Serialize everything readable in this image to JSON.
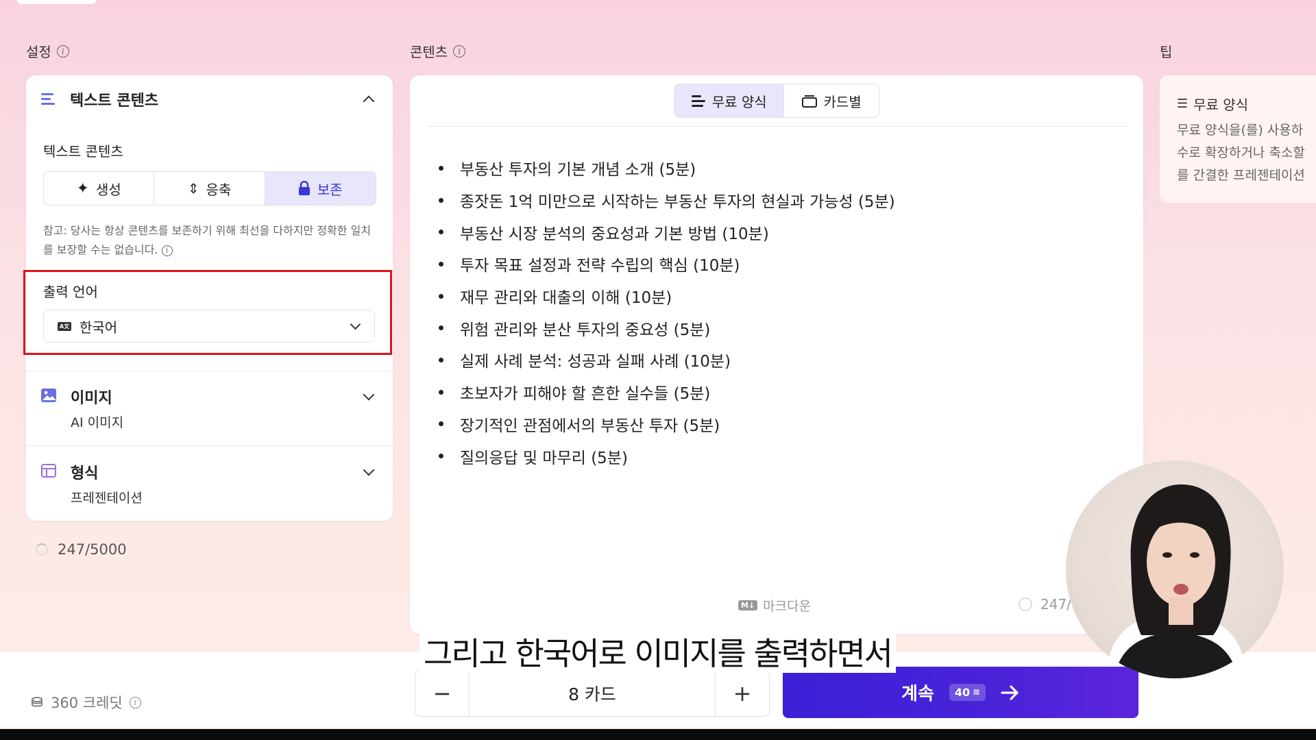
{
  "settings": {
    "label": "설정",
    "text_section": {
      "title": "텍스트 콘텐츠",
      "sub_label": "텍스트 콘텐츠",
      "modes": [
        {
          "label": "생성",
          "icon": "sparkle-icon"
        },
        {
          "label": "응축",
          "icon": "condense-icon"
        },
        {
          "label": "보존",
          "icon": "lock-icon",
          "active": true
        }
      ],
      "note": "참고: 당사는 항상 콘텐츠를 보존하기 위해 최선을 다하지만 정확한 일치를 보장할 수는 없습니다."
    },
    "output_language": {
      "label": "출력 언어",
      "value": "한국어",
      "icon": "language-icon"
    },
    "image_section": {
      "title": "이미지",
      "value": "AI 이미지"
    },
    "format_section": {
      "title": "형식",
      "value": "프레젠테이션"
    },
    "char_count": "247/5000"
  },
  "content": {
    "label": "콘텐츠",
    "tabs": [
      {
        "label": "무료 양식",
        "active": true
      },
      {
        "label": "카드별",
        "active": false
      }
    ],
    "items": [
      "부동산 투자의 기본 개념 소개 (5분)",
      "종잣돈 1억 미만으로 시작하는 부동산 투자의 현실과 가능성 (5분)",
      "부동산 시장 분석의 중요성과 기본 방법 (10분)",
      "투자 목표 설정과 전략 수립의 핵심 (10분)",
      "재무 관리와 대출의 이해 (10분)",
      "위험 관리와 분산 투자의 중요성 (5분)",
      "실제 사례 분석: 성공과 실패 사례 (10분)",
      "초보자가 피해야 할 흔한 실수들 (5분)",
      "장기적인 관점에서의 부동산 투자 (5분)",
      "질의응답 및 마무리 (5분)"
    ],
    "markdown_label": "마크다운",
    "char_count": "247/"
  },
  "tips": {
    "label": "팁",
    "title": "무료 양식",
    "lines": [
      "무료 양식을(를) 사용하",
      "수로 확장하거나 축소할",
      "를 간결한 프레젠테이션"
    ]
  },
  "footer": {
    "credits": "360 크레딧",
    "card_count": "8 카드",
    "minus": "−",
    "plus": "+",
    "continue_label": "계속",
    "continue_cost": "40"
  },
  "caption": "그리고 한국어로 이미지를 출력하면서",
  "colors": {
    "accent": "#3a36d8",
    "highlight": "#e0121f",
    "button": "#4a23d9"
  }
}
